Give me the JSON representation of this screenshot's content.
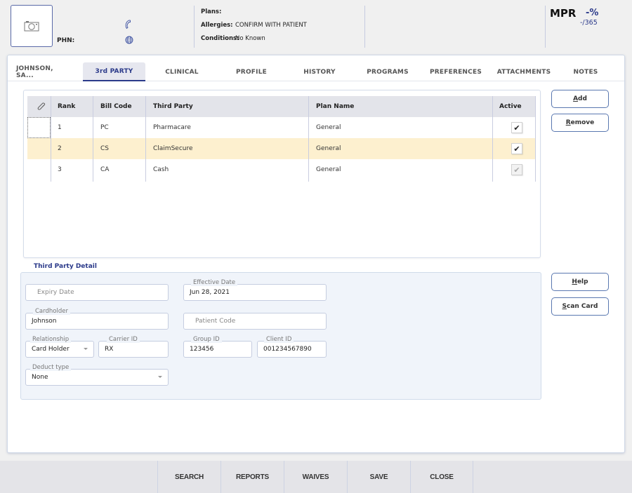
{
  "header": {
    "phn_label": "PHN:",
    "plans_label": "Plans:",
    "plans_value": "",
    "allergies_label": "Allergies:",
    "allergies_value": "CONFIRM WITH PATIENT",
    "conditions_label": "Conditions:",
    "conditions_value": "No Known",
    "mpr_label": "MPR",
    "mpr_percent": "-%",
    "mpr_days": "-/365",
    "icons": {
      "photo": "camera-icon",
      "phone": "phone-icon",
      "web": "globe-icon"
    }
  },
  "tabs": [
    {
      "label": "JOHNSON, SA...",
      "active": false
    },
    {
      "label": "3rd PARTY",
      "active": true
    },
    {
      "label": "CLINICAL",
      "active": false
    },
    {
      "label": "PROFILE",
      "active": false
    },
    {
      "label": "HISTORY",
      "active": false
    },
    {
      "label": "PROGRAMS",
      "active": false
    },
    {
      "label": "PREFERENCES",
      "active": false
    },
    {
      "label": "ATTACHMENTS",
      "active": false
    },
    {
      "label": "NOTES",
      "active": false
    }
  ],
  "grid": {
    "columns": [
      "",
      "Rank",
      "Bill Code",
      "Third Party",
      "Plan Name",
      "Active"
    ],
    "attachment_icon": "paperclip-icon",
    "rows": [
      {
        "rank": "1",
        "bill_code": "PC",
        "third_party": "Pharmacare",
        "plan_name": "General",
        "active": true,
        "active_enabled": true,
        "selected": false
      },
      {
        "rank": "2",
        "bill_code": "CS",
        "third_party": "ClaimSecure",
        "plan_name": "General",
        "active": true,
        "active_enabled": true,
        "selected": true
      },
      {
        "rank": "3",
        "bill_code": "CA",
        "third_party": "Cash",
        "plan_name": "General",
        "active": true,
        "active_enabled": false,
        "selected": false
      }
    ],
    "check_glyph": "✔"
  },
  "side_buttons": {
    "add": {
      "hotkey": "A",
      "rest": "dd"
    },
    "remove": {
      "hotkey": "R",
      "rest": "emove"
    },
    "help": {
      "hotkey": "H",
      "rest": "elp"
    },
    "scan": {
      "hotkey": "S",
      "rest": "can Card"
    }
  },
  "detail": {
    "legend": "Third Party Detail",
    "expiry_date": {
      "label": "",
      "placeholder": "Expiry Date",
      "value": ""
    },
    "effective_date": {
      "label": "Effective Date",
      "value": "Jun 28, 2021"
    },
    "cardholder": {
      "label": "Cardholder",
      "value": "Johnson"
    },
    "patient_code": {
      "label": "",
      "placeholder": "Patient Code",
      "value": ""
    },
    "relationship": {
      "label": "Relationship",
      "value": "Card Holder"
    },
    "carrier_id": {
      "label": "Carrier ID",
      "value": "RX"
    },
    "group_id": {
      "label": "Group ID",
      "value": "123456"
    },
    "client_id": {
      "label": "Client ID",
      "value": "001234567890"
    },
    "deduct_type": {
      "label": "Deduct type",
      "value": "None"
    }
  },
  "bottom_bar": [
    "SEARCH",
    "REPORTS",
    "WAIVES",
    "SAVE",
    "CLOSE"
  ]
}
